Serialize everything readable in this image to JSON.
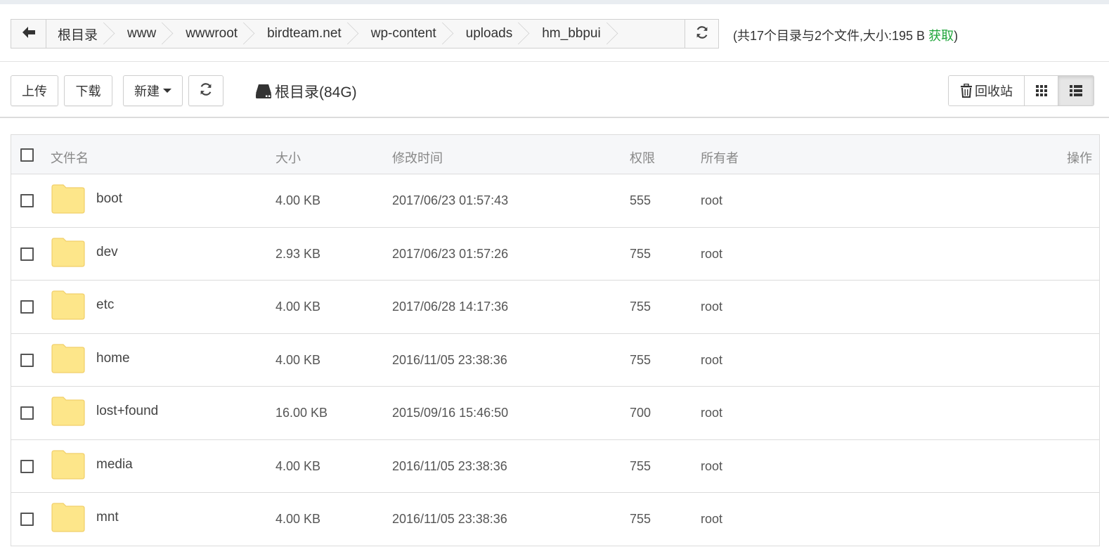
{
  "breadcrumbs": [
    "根目录",
    "www",
    "wwwroot",
    "birdteam.net",
    "wp-content",
    "uploads",
    "hm_bbpui"
  ],
  "summary": {
    "text": "(共17个目录与2个文件,大小:195 B ",
    "fetch_label": "获取",
    "close": ")"
  },
  "toolbar": {
    "upload_label": "上传",
    "download_label": "下载",
    "new_label": "新建",
    "disk_label": "根目录(84G)",
    "recycle_label": "回收站"
  },
  "table": {
    "headers": {
      "name": "文件名",
      "size": "大小",
      "mtime": "修改时间",
      "perm": "权限",
      "owner": "所有者",
      "actions": "操作"
    },
    "rows": [
      {
        "name": "boot",
        "size": "4.00 KB",
        "mtime": "2017/06/23 01:57:43",
        "perm": "555",
        "owner": "root"
      },
      {
        "name": "dev",
        "size": "2.93 KB",
        "mtime": "2017/06/23 01:57:26",
        "perm": "755",
        "owner": "root"
      },
      {
        "name": "etc",
        "size": "4.00 KB",
        "mtime": "2017/06/28 14:17:36",
        "perm": "755",
        "owner": "root"
      },
      {
        "name": "home",
        "size": "4.00 KB",
        "mtime": "2016/11/05 23:38:36",
        "perm": "755",
        "owner": "root"
      },
      {
        "name": "lost+found",
        "size": "16.00 KB",
        "mtime": "2015/09/16 15:46:50",
        "perm": "700",
        "owner": "root"
      },
      {
        "name": "media",
        "size": "4.00 KB",
        "mtime": "2016/11/05 23:38:36",
        "perm": "755",
        "owner": "root"
      },
      {
        "name": "mnt",
        "size": "4.00 KB",
        "mtime": "2016/11/05 23:38:36",
        "perm": "755",
        "owner": "root"
      }
    ]
  },
  "icons": {
    "back": "arrow-left-icon",
    "refresh": "refresh-icon",
    "disk": "hard-drive-icon",
    "trash": "trash-icon",
    "grid": "grid-view-icon",
    "list": "list-view-icon",
    "folder": "folder-icon"
  },
  "colors": {
    "accent_green": "#20a53a",
    "folder_fill": "#fde68a",
    "folder_stroke": "#f1cf6a",
    "header_bg": "#f6f7f9"
  }
}
